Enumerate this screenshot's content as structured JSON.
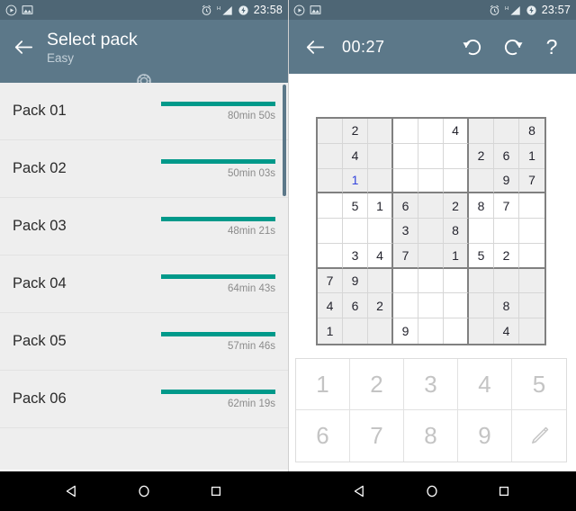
{
  "left": {
    "status_bar": {
      "icons": [
        "play-circle-icon",
        "image-icon"
      ],
      "right_icons": [
        "alarm-icon",
        "signal-h-icon",
        "battery-charging-icon"
      ],
      "time": "23:58"
    },
    "toolbar": {
      "back_icon": "back-arrow-icon",
      "title": "Select pack",
      "subtitle": "Easy",
      "award_icon": "award-ribbon-icon"
    },
    "packs": [
      {
        "name": "Pack 01",
        "time": "80min 50s",
        "progress": 100
      },
      {
        "name": "Pack 02",
        "time": "50min 03s",
        "progress": 100
      },
      {
        "name": "Pack 03",
        "time": "48min 21s",
        "progress": 100
      },
      {
        "name": "Pack 04",
        "time": "64min 43s",
        "progress": 100
      },
      {
        "name": "Pack 05",
        "time": "57min 46s",
        "progress": 100
      },
      {
        "name": "Pack 06",
        "time": "62min 19s",
        "progress": 100
      }
    ],
    "accent_color": "#00998a",
    "toolbar_color": "#5c7889",
    "nav": [
      "back-triangle-icon",
      "home-circle-icon",
      "recents-square-icon"
    ]
  },
  "right": {
    "status_bar": {
      "icons": [
        "play-circle-icon",
        "image-icon"
      ],
      "right_icons": [
        "alarm-icon",
        "signal-h-icon",
        "battery-charging-icon"
      ],
      "time": "23:57"
    },
    "toolbar": {
      "back_icon": "back-arrow-icon",
      "timer": "00:27",
      "undo_icon": "undo-icon",
      "redo_icon": "redo-icon",
      "help_label": "?"
    },
    "sudoku": {
      "given_color": "#24242e",
      "user_color": "#3344dd",
      "shaded_cell_color": "#eeeeee",
      "grid": [
        [
          "",
          "2",
          "",
          "",
          "",
          "4",
          "",
          "",
          "8"
        ],
        [
          "",
          "4",
          "",
          "",
          "",
          "",
          "2",
          "6",
          "1"
        ],
        [
          "",
          "1",
          "",
          "",
          "",
          "",
          "",
          "9",
          "7"
        ],
        [
          "",
          "5",
          "1",
          "6",
          "",
          "2",
          "8",
          "7",
          ""
        ],
        [
          "",
          "",
          "",
          "3",
          "",
          "8",
          "",
          "",
          ""
        ],
        [
          "",
          "3",
          "4",
          "7",
          "",
          "1",
          "5",
          "2",
          ""
        ],
        [
          "7",
          "9",
          "",
          "",
          "",
          "",
          "",
          "",
          ""
        ],
        [
          "4",
          "6",
          "2",
          "",
          "",
          "",
          "",
          "8",
          ""
        ],
        [
          "1",
          "",
          "",
          "9",
          "",
          "",
          "",
          "4",
          ""
        ]
      ],
      "user_cells": [
        [
          2,
          1
        ]
      ]
    },
    "numpad": {
      "keys": [
        "1",
        "2",
        "3",
        "4",
        "5",
        "6",
        "7",
        "8",
        "9"
      ],
      "pencil_icon": "pencil-icon"
    },
    "nav": [
      "back-triangle-icon",
      "home-circle-icon",
      "recents-square-icon"
    ]
  }
}
